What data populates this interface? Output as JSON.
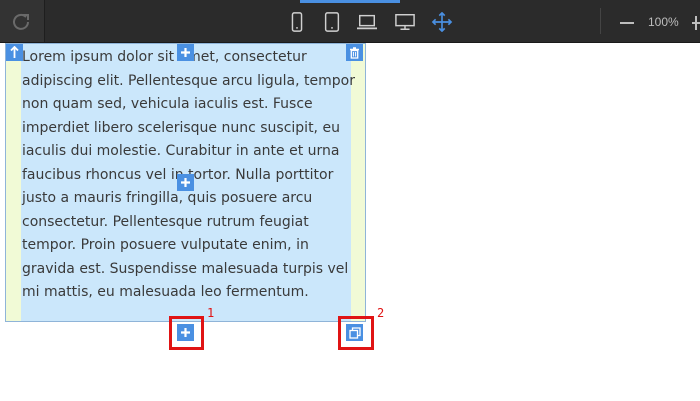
{
  "toolbar": {
    "undo_icon": "redo-arrow-icon",
    "devices": [
      "phone-portrait-icon",
      "tablet-portrait-icon",
      "laptop-icon",
      "desktop-icon",
      "move-arrows-icon"
    ],
    "zoom_label": "100%",
    "accent": "#4a90e2"
  },
  "block": {
    "paragraph": "Lorem ipsum dolor sit amet, consectetur adipiscing elit. Pellentesque arcu ligula, tempor non quam sed, vehicula iaculis est. Fusce imperdiet libero scelerisque nunc suscipit, eu iaculis dui molestie. Curabitur in ante et urna faucibus rhoncus vel in tortor. Nulla porttitor justo a mauris fringilla, quis posuere arcu consectetur. Pellentesque rutrum feugiat tempor. Proin posuere vulputate enim, in gravida est. Suspendisse malesuada turpis vel mi mattis, eu malesuada leo fermentum.",
    "controls": [
      "move-up-icon",
      "add-icon",
      "delete-icon",
      "add-icon",
      "add-below-icon",
      "duplicate-icon"
    ],
    "colors": {
      "content": "#cbe7fb",
      "padding": "#f1fad6",
      "border": "#8fb4d8"
    }
  },
  "annotations": {
    "marker_1": "1",
    "marker_2": "2",
    "color": "#e01414"
  }
}
